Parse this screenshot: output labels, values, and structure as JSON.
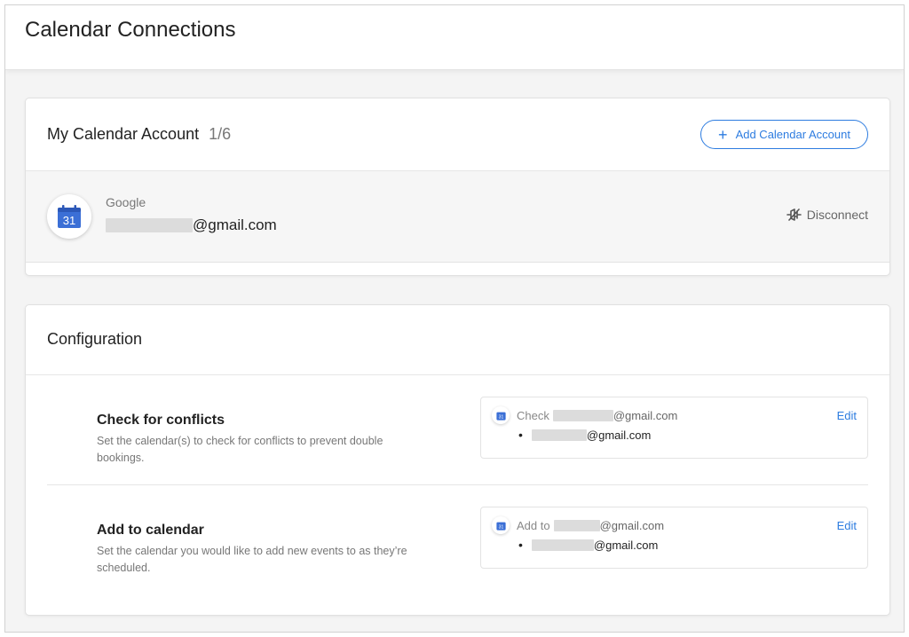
{
  "page": {
    "title": "Calendar Connections"
  },
  "accounts": {
    "title": "My Calendar Account",
    "count": "1/6",
    "add_label": "Add Calendar Account",
    "items": [
      {
        "provider": "Google",
        "email_suffix": "@gmail.com",
        "disconnect_label": "Disconnect",
        "calendar_day": "31"
      }
    ]
  },
  "configuration": {
    "title": "Configuration",
    "sections": [
      {
        "title": "Check for conflicts",
        "description": "Set the calendar(s) to check for conflicts to prevent double bookings.",
        "prefix": "Check",
        "account_suffix": "@gmail.com",
        "calendar_suffix": "@gmail.com",
        "edit_label": "Edit"
      },
      {
        "title": "Add to calendar",
        "description": "Set the calendar you would like to add new events to as they’re scheduled.",
        "prefix": "Add to",
        "account_suffix": "@gmail.com",
        "calendar_suffix": "@gmail.com",
        "edit_label": "Edit"
      }
    ]
  },
  "colors": {
    "accent": "#2d7ce0",
    "google_calendar_blue": "#3b6fd6"
  },
  "icons": {
    "calendar": "google-calendar-icon",
    "disconnect": "disconnect-plug-icon",
    "add": "plus-icon"
  }
}
